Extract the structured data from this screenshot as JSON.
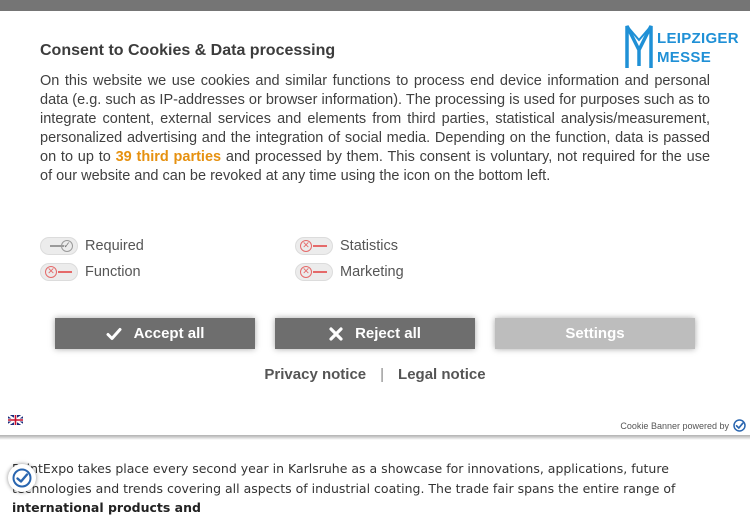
{
  "dialog": {
    "title": "Consent to Cookies & Data processing",
    "logo": {
      "line1": "LEIPZIGER",
      "line2": "MESSE",
      "color": "#1f90d6"
    },
    "text_part1": "On this website we use cookies and similar functions to process end device information and personal data (e.g. such as IP-addresses or browser information). The processing is used for purposes such as to integrate content, external services and elements from third parties, statistical analysis/measurement, personalized advertising and the integration of social media. Depending on the function, data is passed on to up to ",
    "text_highlight": "39 third parties",
    "text_part2": " and processed by them. This consent is voluntary, not required for the use of our website and can be revoked at any time using the icon on the bottom left.",
    "highlight_color": "#e69110"
  },
  "options": {
    "required": {
      "label": "Required",
      "state": "on"
    },
    "statistics": {
      "label": "Statistics",
      "state": "off"
    },
    "function": {
      "label": "Function",
      "state": "off"
    },
    "marketing": {
      "label": "Marketing",
      "state": "off"
    }
  },
  "buttons": {
    "accept_all": "Accept all",
    "reject_all": "Reject all",
    "settings": "Settings"
  },
  "links": {
    "privacy": "Privacy notice",
    "separator": "|",
    "legal": "Legal notice"
  },
  "footer": {
    "powered_by": "Cookie Banner powered by",
    "language_icon": "language-flag-icon"
  },
  "page": {
    "text_start": "PaintExpo takes place every second year in Karlsruhe as a showcase for innovations, applications, future technologies and trends covering all aspects of industrial coating. The trade fair spans the entire range of ",
    "text_bold": "international products and"
  },
  "colors": {
    "button_dark": "#6e6e6e",
    "button_light": "#bdbdbd",
    "toggle_off": "#e56a6a"
  }
}
